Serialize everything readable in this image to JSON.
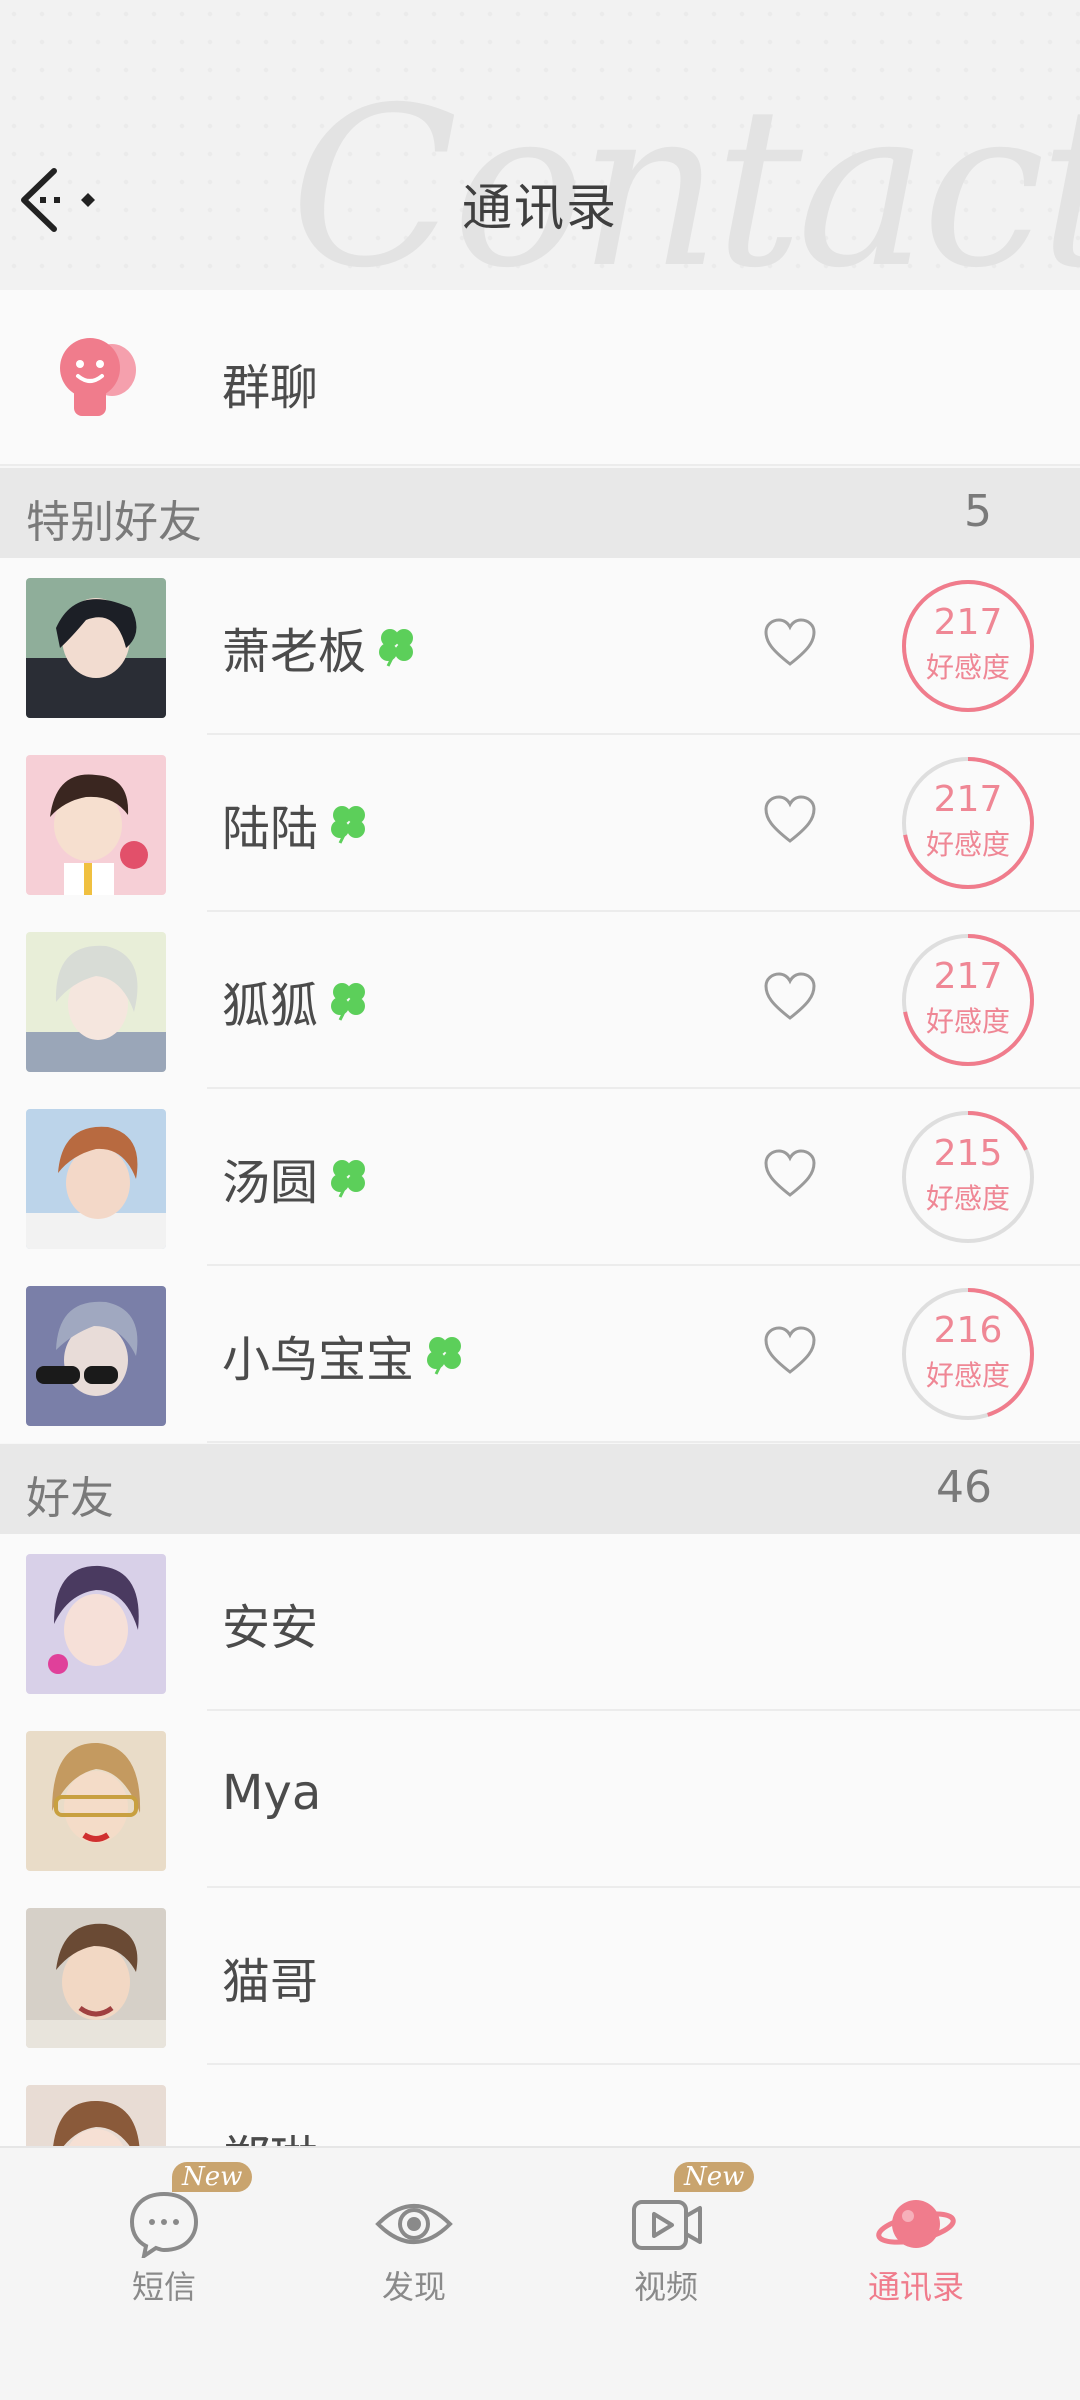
{
  "header": {
    "title": "通讯录",
    "watermark": "Contacts"
  },
  "group_chat": {
    "label": "群聊"
  },
  "special_friends": {
    "title": "特别好友",
    "count": "5",
    "items": [
      {
        "name": "萧老板",
        "affinity": "217",
        "affinity_label": "好感度",
        "progress": 1.0
      },
      {
        "name": "陆陆",
        "affinity": "217",
        "affinity_label": "好感度",
        "progress": 0.72
      },
      {
        "name": "狐狐",
        "affinity": "217",
        "affinity_label": "好感度",
        "progress": 0.72
      },
      {
        "name": "汤圆",
        "affinity": "215",
        "affinity_label": "好感度",
        "progress": 0.18
      },
      {
        "name": "小鸟宝宝",
        "affinity": "216",
        "affinity_label": "好感度",
        "progress": 0.45
      }
    ]
  },
  "friends": {
    "title": "好友",
    "count": "46",
    "items": [
      {
        "name": "安安"
      },
      {
        "name": "Mya"
      },
      {
        "name": "猫哥"
      },
      {
        "name": "郑琳"
      }
    ]
  },
  "bottom_nav": {
    "items": [
      {
        "label": "短信",
        "badge": "New"
      },
      {
        "label": "发现",
        "badge": ""
      },
      {
        "label": "视频",
        "badge": "New"
      },
      {
        "label": "通讯录",
        "badge": ""
      }
    ],
    "active": "通讯录"
  },
  "colors": {
    "accent": "#f07c8c",
    "clover": "#5ccf5a",
    "badge": "#c9a46e"
  }
}
